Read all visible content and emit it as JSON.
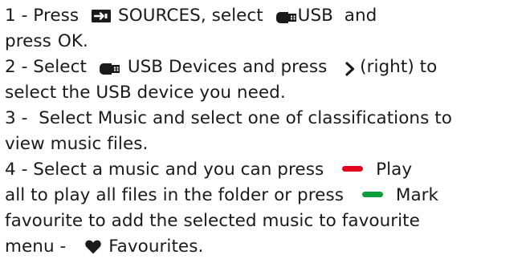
{
  "colors": {
    "text": "#1a1a1a",
    "red_key": "#e3001b",
    "green_key": "#0a9e3a"
  },
  "icons": {
    "sources": "sources-icon",
    "usb": "usb-icon",
    "chevron": "chevron-right-icon",
    "red": "red-key-icon",
    "green": "green-key-icon",
    "heart": "heart-icon"
  },
  "steps": {
    "s1": {
      "line1_pre": "1 -  Press",
      "sources": "SOURCES",
      "mid": ", select",
      "usb": "USB",
      "tail": "  and",
      "line2_pre": "press",
      "ok": "OK",
      "line2_end": "."
    },
    "s2": {
      "pre": "2 -  Select",
      "usb_devices": "USB Devices",
      "mid": " and press ",
      "right": "(right) to",
      "line2": "select the USB device you need."
    },
    "s3": {
      "pre": "3 -  Select ",
      "music": "Music",
      "rest": " and select one of classifications to",
      "line2": "view music files."
    },
    "s4": {
      "pre": "4 -  Select a music and you can press",
      "play": "Play",
      "all": "all",
      "mid": " to play all files in the folder or press",
      "mark": "Mark",
      "favourite": "favourite",
      "rest": " to add the selected music to favourite",
      "menu_pre": "menu -",
      "favourites": "Favourites",
      "end": "."
    }
  }
}
